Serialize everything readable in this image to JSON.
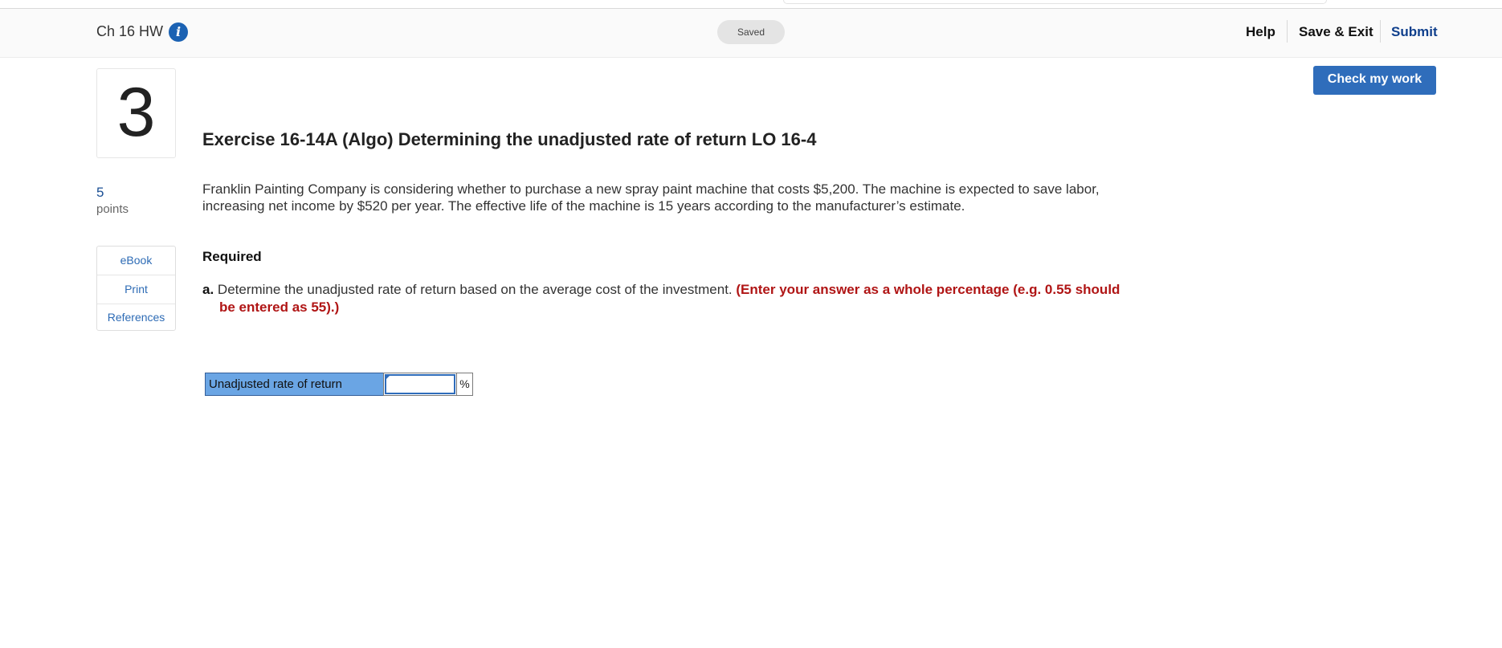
{
  "header": {
    "assignment_title": "Ch 16 HW",
    "status": "Saved",
    "help": "Help",
    "save_exit": "Save & Exit",
    "submit": "Submit"
  },
  "check_button": "Check my work",
  "question": {
    "number": "3",
    "points_value": "5",
    "points_label": "points",
    "title": "Exercise 16-14A (Algo) Determining the unadjusted rate of return LO 16-4",
    "body": "Franklin Painting Company is considering whether to purchase a new spray paint machine that costs $5,200. The machine is expected to save labor, increasing net income by $520 per year. The effective life of the machine is 15 years according to the manufacturer’s estimate.",
    "required_label": "Required",
    "part_a_label": "a.",
    "part_a_text": "Determine the unadjusted rate of return based on the average cost of the investment.",
    "part_a_note": "(Enter your answer as a whole percentage (e.g. 0.55 should be entered as 55).)"
  },
  "resources": {
    "ebook": "eBook",
    "print": "Print",
    "references": "References"
  },
  "answer": {
    "label": "Unadjusted rate of return",
    "value": "",
    "unit": "%"
  }
}
